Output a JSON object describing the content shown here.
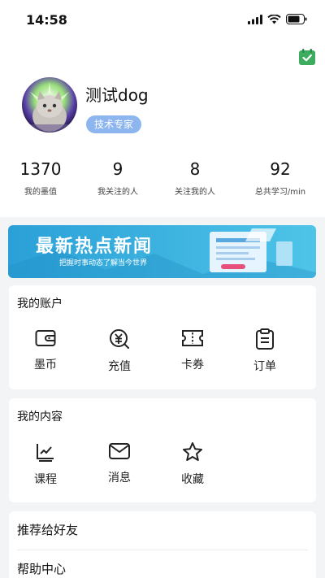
{
  "status_bar": {
    "time": "14:58"
  },
  "profile": {
    "username": "测试dog",
    "badge": "技术专家",
    "stats": [
      {
        "value": "1370",
        "label": "我的墨值"
      },
      {
        "value": "9",
        "label": "我关注的人"
      },
      {
        "value": "8",
        "label": "关注我的人"
      },
      {
        "value": "92",
        "label": "总共学习/min"
      }
    ]
  },
  "banner": {
    "headline": "最新热点新闻",
    "subline": "把握时事动态了解当今世界"
  },
  "account": {
    "title": "我的账户",
    "items": [
      {
        "label": "墨币",
        "icon": "wallet-icon"
      },
      {
        "label": "充值",
        "icon": "recharge-icon"
      },
      {
        "label": "卡券",
        "icon": "ticket-icon"
      },
      {
        "label": "订单",
        "icon": "order-icon"
      }
    ]
  },
  "content": {
    "title": "我的内容",
    "items": [
      {
        "label": "课程",
        "icon": "course-icon"
      },
      {
        "label": "消息",
        "icon": "message-icon"
      },
      {
        "label": "收藏",
        "icon": "star-icon"
      }
    ]
  },
  "menu": {
    "recommend": "推荐给好友",
    "help": "帮助中心"
  },
  "colors": {
    "badge": "#8db6ef",
    "checkin": "#3dac5e",
    "banner_start": "#2aa0d8",
    "banner_end": "#4fc4e8"
  }
}
